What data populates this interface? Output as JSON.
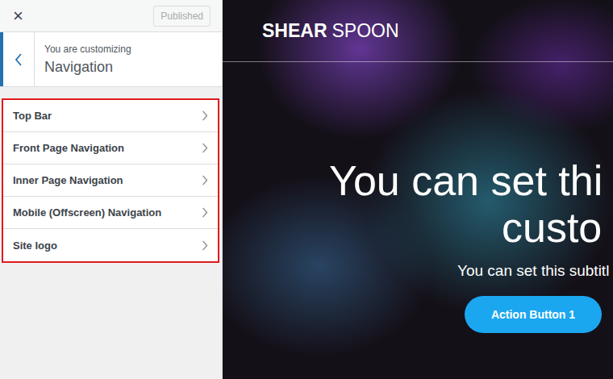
{
  "toolbar": {
    "close": "×",
    "publish": {
      "label": "Published",
      "disabled": true
    }
  },
  "header": {
    "eyebrow": "You are customizing",
    "title": "Navigation"
  },
  "sections": [
    {
      "label": "Top Bar"
    },
    {
      "label": "Front Page Navigation"
    },
    {
      "label": "Inner Page Navigation"
    },
    {
      "label": "Mobile (Offscreen) Navigation"
    },
    {
      "label": "Site logo"
    }
  ],
  "preview": {
    "logo": {
      "strong": "SHEAR",
      "light": "SPOON"
    },
    "headline": [
      "You can set thi",
      "custo"
    ],
    "subtitle": "You can set this subtitl",
    "button": "Action Button 1"
  }
}
